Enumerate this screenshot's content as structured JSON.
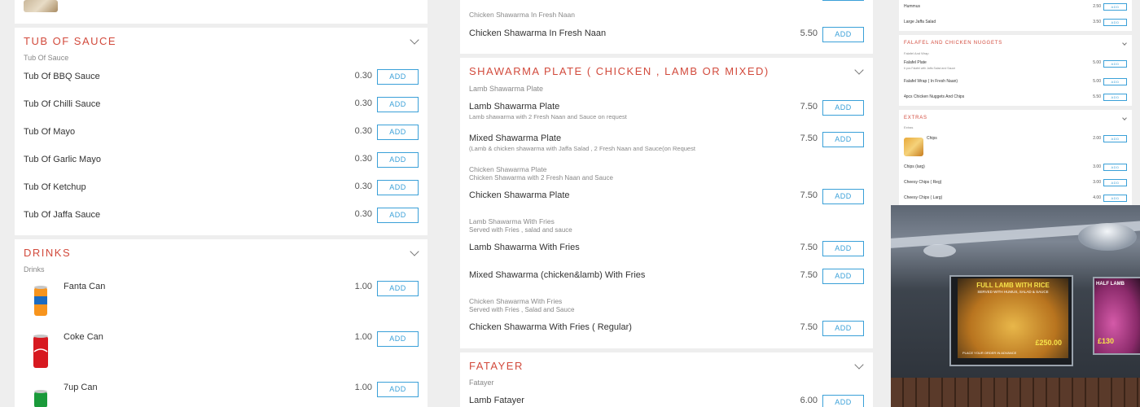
{
  "left": {
    "tub_sauce": {
      "title": "Tub Of Sauce",
      "subtitle": "Tub Of Sauce",
      "items": [
        {
          "name": "Tub Of BBQ Sauce",
          "price": "0.30"
        },
        {
          "name": "Tub Of Chilli Sauce",
          "price": "0.30"
        },
        {
          "name": "Tub Of Mayo",
          "price": "0.30"
        },
        {
          "name": "Tub Of Garlic Mayo",
          "price": "0.30"
        },
        {
          "name": "Tub Of Ketchup",
          "price": "0.30"
        },
        {
          "name": "Tub Of Jaffa Sauce",
          "price": "0.30"
        }
      ]
    },
    "drinks": {
      "title": "Drinks",
      "subtitle": "Drinks",
      "items": [
        {
          "name": "Fanta Can",
          "price": "1.00"
        },
        {
          "name": "Coke Can",
          "price": "1.00"
        },
        {
          "name": "7up Can",
          "price": "1.00"
        }
      ]
    }
  },
  "middle": {
    "top_item": {
      "group": "Chicken Shawarma In Fresh Naan",
      "name": "Chicken Shawarma In Fresh Naan",
      "price": "5.50"
    },
    "shawarma_plate": {
      "title": "Shawarma Plate ( Chicken , Lamb Or Mixed)",
      "subtitle": "Lamb Shawarma Plate",
      "items": [
        {
          "name": "Lamb Shawarma Plate",
          "desc": "Lamb shawarma with 2 Fresh Naan and Sauce on request",
          "price": "7.50"
        },
        {
          "name": "Mixed Shawarma Plate",
          "desc": "(Lamb & chicken shawarma with Jaffa Salad , 2 Fresh Naan and Sauce(on Request",
          "price": "7.50"
        },
        {
          "group": "Chicken Shawarma Plate",
          "group_desc": "Chicken Shawarma with 2 Fresh Naan and Sauce",
          "name": "Chicken Shawarma Plate",
          "price": "7.50"
        },
        {
          "group": "Lamb Shawarma With Fries",
          "group_desc": "Served with Fries , salad and sauce",
          "name": "Lamb Shawarma With Fries",
          "price": "7.50"
        },
        {
          "name": "Mixed Shawarma (chicken&lamb) With Fries",
          "price": "7.50"
        },
        {
          "group": "Chicken Shawarma With Fries",
          "group_desc": "Served with Fries , Salad and Sauce",
          "name": "Chicken Shawarma With Fries ( Regular)",
          "price": "7.50"
        }
      ]
    },
    "fatayer": {
      "title": "Fatayer",
      "subtitle": "Fatayer",
      "items": [
        {
          "name": "Lamb Fatayer",
          "price": "6.00"
        }
      ]
    }
  },
  "right": {
    "top_items": [
      {
        "name": "Hummus",
        "price": "2.50"
      },
      {
        "name": "Large Jaffa Salad",
        "price": "3.50"
      }
    ],
    "falafel": {
      "title": "Falafel And Chicken Nuggets",
      "subtitle": "Falafel And Wrap",
      "items": [
        {
          "name": "Falafel Plate",
          "desc": "6 pcs Falafel with Jaffa Salad and Sauce",
          "price": "5.00"
        },
        {
          "name": "Falafel Wrap ( In Fresh Naan)",
          "price": "5.00"
        },
        {
          "name": "4pcs Chicken Nuggets And Chips",
          "price": "5.50"
        }
      ]
    },
    "extras": {
      "title": "Extras",
      "subtitle": "Extras",
      "items": [
        {
          "name": "Chips",
          "price": "2.00"
        },
        {
          "name": "Chips (larg)",
          "price": "3.00"
        },
        {
          "name": "Cheesy Chips ( Reg)",
          "price": "3.00"
        },
        {
          "name": "Cheesy Chips ( Larg)",
          "price": "4.00"
        }
      ]
    }
  },
  "photo": {
    "poster_left_title": "FULL LAMB WITH RICE",
    "poster_left_sub": "SERVED WITH HUMUS, SALAD & SAUCE",
    "poster_left_price": "£250.00",
    "poster_left_foot": "PLACE YOUR ORDER IN ADVANCE",
    "poster_right_title": "HALF LAMB",
    "poster_right_price": "£130"
  },
  "add_label": "ADD",
  "colors": {
    "accent": "#d24a3c",
    "button": "#3aa0d8",
    "bg": "#eeeeee"
  }
}
